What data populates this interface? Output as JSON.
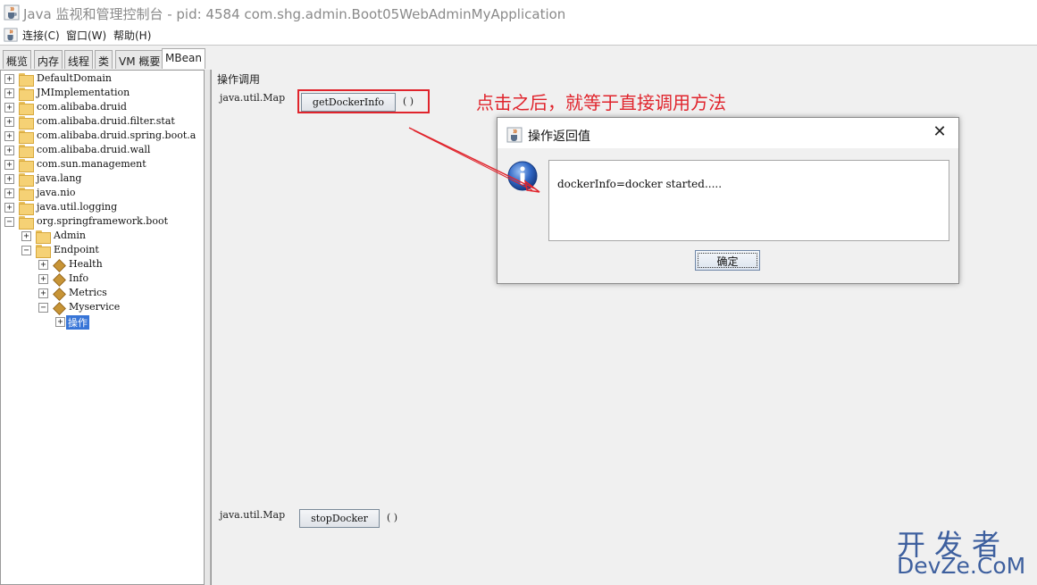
{
  "window": {
    "title": "Java 监视和管理控制台 - pid: 4584 com.shg.admin.Boot05WebAdminMyApplication"
  },
  "menu": [
    "连接(C)",
    "窗口(W)",
    "帮助(H)"
  ],
  "tabs": [
    "概览",
    "内存",
    "线程",
    "类",
    "VM 概要",
    "MBean"
  ],
  "active_tab": "MBean",
  "tree": [
    {
      "label": "DefaultDomain",
      "level": 0,
      "expander": "+",
      "icon": "folder"
    },
    {
      "label": "JMImplementation",
      "level": 0,
      "expander": "+",
      "icon": "folder"
    },
    {
      "label": "com.alibaba.druid",
      "level": 0,
      "expander": "+",
      "icon": "folder"
    },
    {
      "label": "com.alibaba.druid.filter.stat",
      "level": 0,
      "expander": "+",
      "icon": "folder"
    },
    {
      "label": "com.alibaba.druid.spring.boot.a",
      "level": 0,
      "expander": "+",
      "icon": "folder"
    },
    {
      "label": "com.alibaba.druid.wall",
      "level": 0,
      "expander": "+",
      "icon": "folder"
    },
    {
      "label": "com.sun.management",
      "level": 0,
      "expander": "+",
      "icon": "folder"
    },
    {
      "label": "java.lang",
      "level": 0,
      "expander": "+",
      "icon": "folder"
    },
    {
      "label": "java.nio",
      "level": 0,
      "expander": "+",
      "icon": "folder"
    },
    {
      "label": "java.util.logging",
      "level": 0,
      "expander": "+",
      "icon": "folder"
    },
    {
      "label": "org.springframework.boot",
      "level": 0,
      "expander": "−",
      "icon": "folder"
    },
    {
      "label": "Admin",
      "level": 1,
      "expander": "+",
      "icon": "folder"
    },
    {
      "label": "Endpoint",
      "level": 1,
      "expander": "−",
      "icon": "folder"
    },
    {
      "label": "Health",
      "level": 2,
      "expander": "+",
      "icon": "bean"
    },
    {
      "label": "Info",
      "level": 2,
      "expander": "+",
      "icon": "bean"
    },
    {
      "label": "Metrics",
      "level": 2,
      "expander": "+",
      "icon": "bean"
    },
    {
      "label": "Myservice",
      "level": 2,
      "expander": "−",
      "icon": "bean"
    },
    {
      "label": "操作",
      "level": 3,
      "expander": "+",
      "icon": "none",
      "selected": true
    }
  ],
  "panel": {
    "title": "操作调用",
    "operations": [
      {
        "return_type": "java.util.Map",
        "name": "getDockerInfo",
        "params": "( )"
      },
      {
        "return_type": "java.util.Map",
        "name": "stopDocker",
        "params": "( )"
      }
    ]
  },
  "annotation": "点击之后，就等于直接调用方法",
  "dialog": {
    "title": "操作返回值",
    "message": "dockerInfo=docker started.....",
    "ok_label": "确定",
    "close_glyph": "✕"
  },
  "watermark": {
    "line1": "开发者",
    "line2": "DevZe.CoM"
  },
  "colors": {
    "annotation_red": "#e0242c",
    "selection_blue": "#3875d7",
    "watermark_blue": "#3d5f9e"
  },
  "icons": {
    "app": "java-coffee-cup-icon",
    "info": "info-icon",
    "close": "close-icon"
  }
}
